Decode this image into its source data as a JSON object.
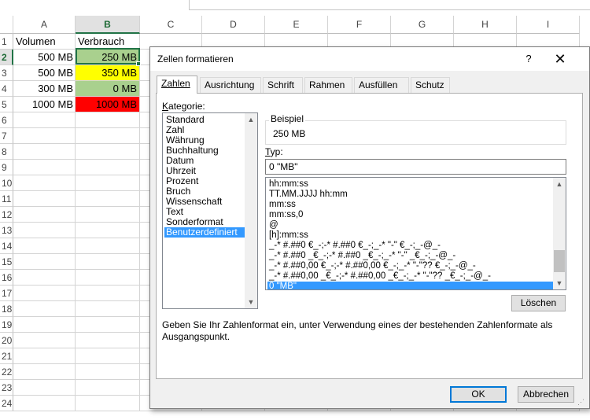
{
  "spreadsheet": {
    "columns": [
      "A",
      "B",
      "C",
      "D",
      "E",
      "F",
      "G",
      "H",
      "I"
    ],
    "selected_column": "B",
    "rows": [
      "1",
      "2",
      "3",
      "4",
      "5",
      "6",
      "7",
      "8",
      "9",
      "10",
      "11",
      "12",
      "13",
      "14",
      "15",
      "16",
      "17",
      "18",
      "19",
      "20",
      "21",
      "22",
      "23",
      "24"
    ],
    "selected_row": "2",
    "header": {
      "a1": "Volumen",
      "b1": "Verbrauch"
    },
    "data_rows": [
      {
        "volumen": "500 MB",
        "verbrauch": "250 MB",
        "fill": "#a9d08e",
        "text_color": "#000000"
      },
      {
        "volumen": "500 MB",
        "verbrauch": "350 MB",
        "fill": "#ffff00",
        "text_color": "#000000"
      },
      {
        "volumen": "300 MB",
        "verbrauch": "0 MB",
        "fill": "#a9d08e",
        "text_color": "#000000"
      },
      {
        "volumen": "1000 MB",
        "verbrauch": "1000 MB",
        "fill": "#ff0000",
        "text_color": "#000000"
      }
    ],
    "accent": "#217346"
  },
  "dialog": {
    "title": "Zellen formatieren",
    "help_label": "?",
    "close_icon": "close-icon",
    "tabs": [
      {
        "label": "Zahlen",
        "active": true
      },
      {
        "label": "Ausrichtung",
        "active": false
      },
      {
        "label": "Schrift",
        "active": false
      },
      {
        "label": "Rahmen",
        "active": false
      },
      {
        "label": "Ausfüllen",
        "active": false
      },
      {
        "label": "Schutz",
        "active": false
      }
    ],
    "kategorie_label": "Kategorie:",
    "kategorien": [
      "Standard",
      "Zahl",
      "Währung",
      "Buchhaltung",
      "Datum",
      "Uhrzeit",
      "Prozent",
      "Bruch",
      "Wissenschaft",
      "Text",
      "Sonderformat",
      "Benutzerdefiniert"
    ],
    "selected_kategorie": "Benutzerdefiniert",
    "beispiel_label": "Beispiel",
    "beispiel_value": "250 MB",
    "typ_label": "Typ:",
    "typ_value": "0 \"MB\"",
    "formats": [
      "hh:mm:ss",
      "TT.MM.JJJJ hh:mm",
      "mm:ss",
      "mm:ss,0",
      "@",
      "[h]:mm:ss",
      "_-* #.##0 €_-;-* #.##0 €_-;_-* \"-\" €_-;_-@_-",
      "_-* #.##0 _€_-;-* #.##0 _€_-;_-* \"-\" _€_-;_-@_-",
      "_-* #.##0,00 €_-;-* #.##0,00 €_-;_-* \"-\"?? €_-;_-@_-",
      "_-* #.##0,00 _€_-;-* #.##0,00 _€_-;_-* \"-\"?? _€_-;_-@_-",
      "0 \"MB\""
    ],
    "selected_format": "0 \"MB\"",
    "loeschen_label": "Löschen",
    "hint": "Geben Sie Ihr Zahlenformat ein, unter Verwendung eines der bestehenden Zahlenformate als Ausgangspunkt.",
    "ok_label": "OK",
    "abbrechen_label": "Abbrechen",
    "selection_color": "#3399ff",
    "default_button_border": "#0078d7"
  }
}
